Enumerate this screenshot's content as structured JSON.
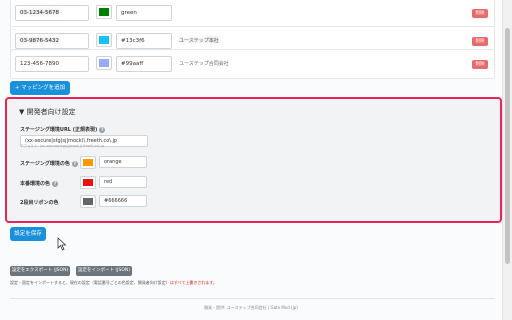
{
  "rows": [
    {
      "phone": "03-1234-5678",
      "phone_blurred": true,
      "color": "#008000",
      "hex": "green",
      "label": "",
      "delete_label": "削除"
    },
    {
      "phone": "03-9876-5432",
      "phone_blurred": true,
      "color": "#13c3f6",
      "hex": "#13c3f6",
      "label": "ユーステップ本社",
      "label_blurred": true,
      "delete_label": "削除"
    },
    {
      "phone": "123-456-7890",
      "phone_blurred": false,
      "color": "#99aaff",
      "hex": "#99aaff",
      "label": "ユーステップ合同会社",
      "delete_label": "削除"
    }
  ],
  "add_mapping_label": "+ マッピングを追加",
  "dev_settings": {
    "title": "▼ 開発者向け設定",
    "staging_url_label": "ステージング環境URL (正規表現)",
    "staging_url_value": "(xx-secure|stg|sj|mock)\\.freeth.co\\.jp",
    "staging_url_hint": "デフォルト: (xx-secure|stg|sj|mock)\\.freeth.co\\.jp",
    "staging_color_label": "ステージング環境の色",
    "staging_color": "#ff9900",
    "staging_color_value": "orange",
    "prod_color_label": "本番環境の色",
    "prod_color": "#ee1111",
    "prod_color_value": "red",
    "ribbon_color_label": "2段目リボンの色",
    "ribbon_color": "#666666",
    "ribbon_color_value": "#666666"
  },
  "save_label": "設定を保存",
  "export_label": "設定をエクスポート (JSON)",
  "import_label": "設定をインポート (JSON)",
  "note_text": "設定・固定をインポートすると、現在の設定（電話番号ごとの色設定、開発者向け設定）",
  "note_warning": "はすべて上書きされます。",
  "footer": "開発・提供: ユーステップ合同会社 | Gate Mod (jp)"
}
